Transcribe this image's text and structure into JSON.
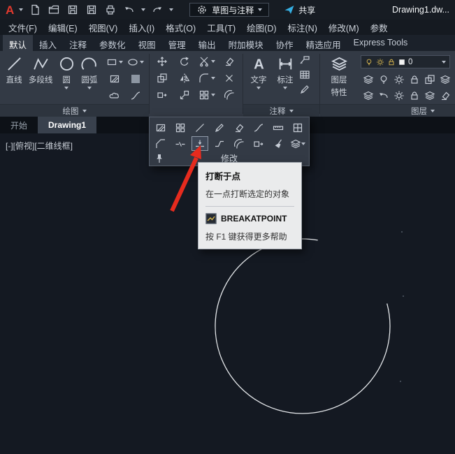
{
  "titlebar": {
    "logo": "A",
    "workspace": "草图与注释",
    "share": "共享",
    "filename": "Drawing1.dw..."
  },
  "menubar": {
    "items": [
      "文件(F)",
      "编辑(E)",
      "视图(V)",
      "插入(I)",
      "格式(O)",
      "工具(T)",
      "绘图(D)",
      "标注(N)",
      "修改(M)",
      "参数"
    ]
  },
  "ribbon": {
    "tabs": [
      "默认",
      "插入",
      "注释",
      "参数化",
      "视图",
      "管理",
      "输出",
      "附加模块",
      "协作",
      "精选应用",
      "Express Tools"
    ],
    "active_tab": "默认",
    "draw": {
      "label": "绘图",
      "line": "直线",
      "polyline": "多段线",
      "circle": "圆",
      "arc": "圆弧"
    },
    "annotate": {
      "label": "注释",
      "text": "文字",
      "dimension": "标注"
    },
    "layers": {
      "label": "图层",
      "prop1": "图层",
      "prop2": "特性",
      "current": "0"
    }
  },
  "file_tabs": {
    "start": "开始",
    "active": "Drawing1"
  },
  "canvas": {
    "viewport_label": "[-][俯视][二维线框]"
  },
  "modify_flyout": {
    "label": "修改"
  },
  "tooltip": {
    "title": "打断于点",
    "description": "在一点打断选定的对象",
    "command": "BREAKATPOINT",
    "help": "按 F1 键获得更多帮助"
  },
  "colors": {
    "accent_red": "#e62b1e",
    "circle_stroke": "#e4e7ea",
    "share_icon": "#35aee2",
    "ribbon_bg": "#333a45",
    "canvas_bg": "#141922",
    "tooltip_bg": "#eaebec"
  }
}
